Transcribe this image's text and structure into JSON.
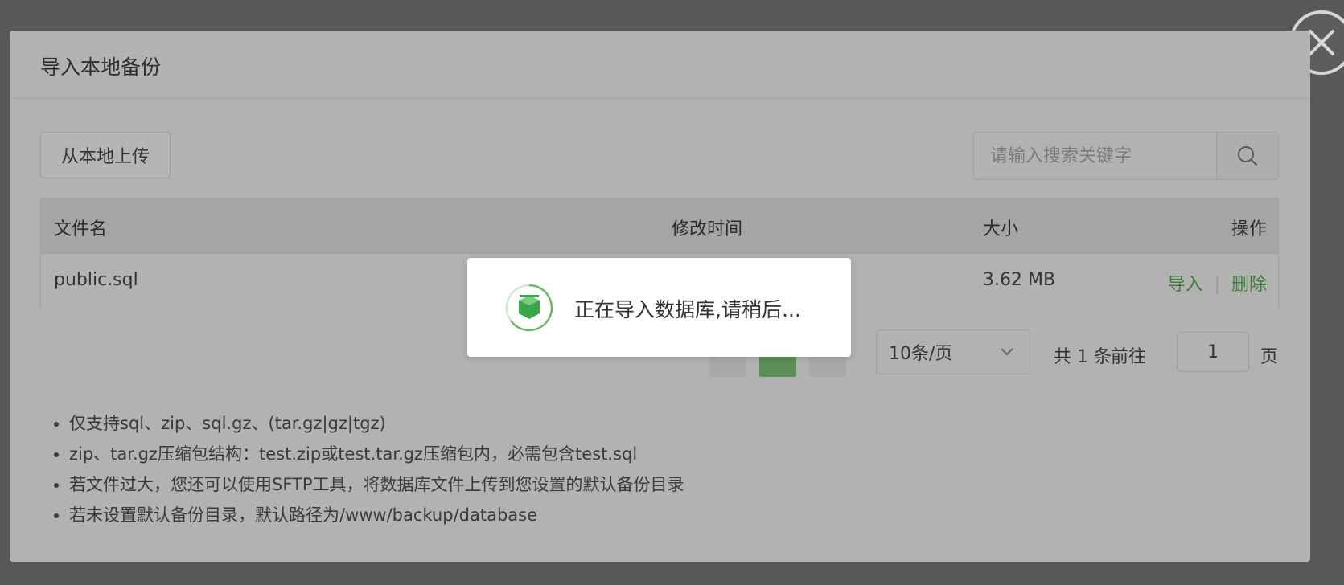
{
  "dialog": {
    "title": "导入本地备份",
    "upload_label": "从本地上传",
    "search": {
      "placeholder": "请输入搜索关键字",
      "icon": "search-icon"
    },
    "table": {
      "headers": {
        "name": "文件名",
        "modified": "修改时间",
        "size": "大小",
        "actions": "操作"
      },
      "rows": [
        {
          "name": "public.sql",
          "size": "3.62 MB",
          "action_import": "导入",
          "action_delete": "删除"
        }
      ]
    },
    "pagination": {
      "page_size": "10条/页",
      "total": "共 1 条",
      "goto_label": "前往",
      "current_page": "1",
      "page_suffix": "页"
    },
    "notes": [
      "仅支持sql、zip、sql.gz、(tar.gz|gz|tgz)",
      "zip、tar.gz压缩包结构：test.zip或test.tar.gz压缩包内，必需包含test.sql",
      "若文件过大，您还可以使用SFTP工具，将数据库文件上传到您设置的默认备份目录",
      "若未设置默认备份目录，默认路径为/www/backup/database"
    ]
  },
  "loading": {
    "text": "正在导入数据库,请稍后...",
    "icon": "loading-logo-icon",
    "accent_color": "#20a53a"
  },
  "colors": {
    "overlay": "#585858",
    "dialog_dimmed": "#b2b2b2",
    "link_green": "#3f7d3a"
  }
}
